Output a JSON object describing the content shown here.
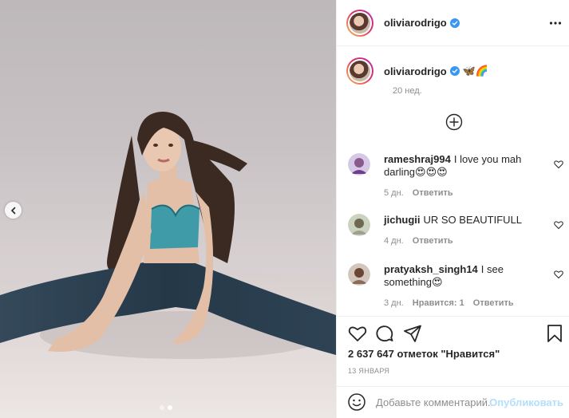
{
  "post": {
    "author": "oliviarodrigo",
    "verified": true,
    "more_icon": "more-options-icon"
  },
  "caption": {
    "username": "oliviarodrigo",
    "emoji": "🦋🌈",
    "time": "20 нед."
  },
  "comments": [
    {
      "username": "rameshraj994",
      "text": "I love you mah darling😍😍😍",
      "time": "5 дн.",
      "reply": "Ответить",
      "likes": ""
    },
    {
      "username": "jichugii",
      "text": "UR SO BEAUTIFULL",
      "time": "4 дн.",
      "reply": "Ответить",
      "likes": ""
    },
    {
      "username": "pratyaksh_singh14",
      "text": "I see something😍",
      "time": "3 дн.",
      "reply": "Ответить",
      "likes": "Нравится: 1"
    }
  ],
  "stats": {
    "likes": "2 637 647 отметок \"Нравится\"",
    "date": "13 ЯНВАРЯ"
  },
  "comment_input": {
    "placeholder": "Добавьте комментарий...",
    "publish_label": "Опубликовать"
  },
  "carousel": {
    "total": 2,
    "active": 2
  },
  "colors": {
    "link_disabled": "#b2dffc",
    "muted": "#8e8e8e",
    "text": "#262626",
    "verified": "#3897f0"
  }
}
